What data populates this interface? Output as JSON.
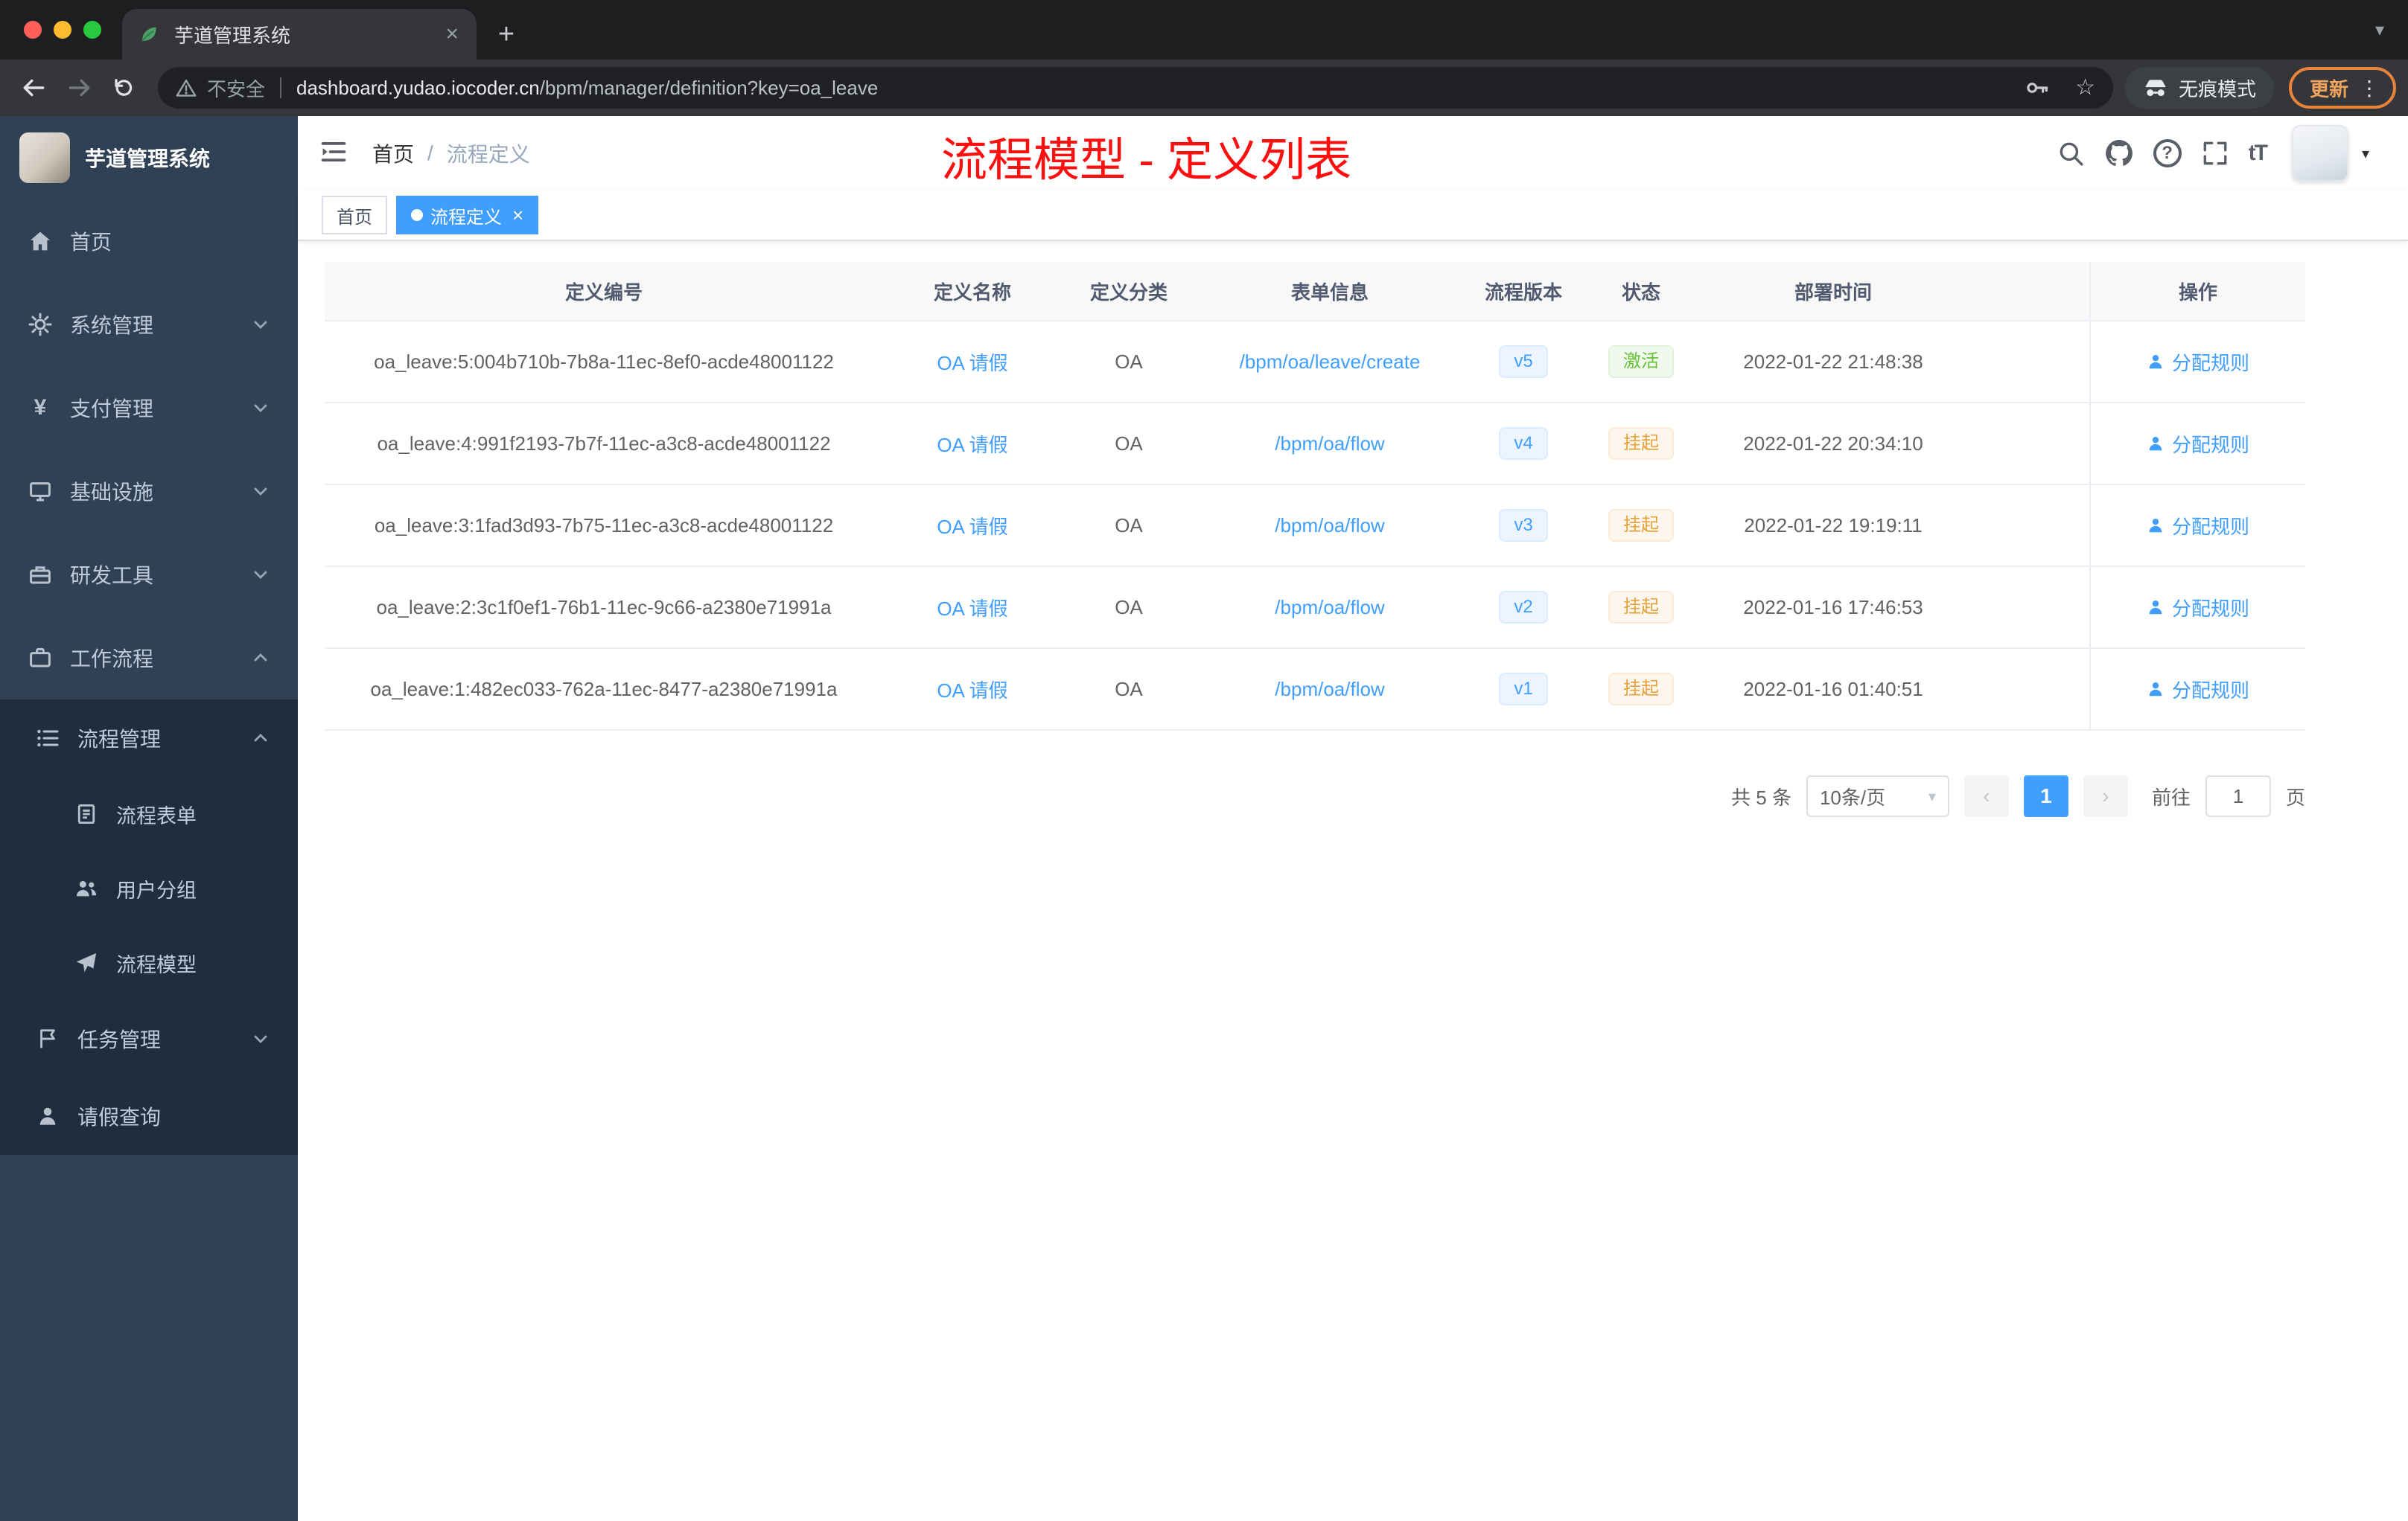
{
  "browser": {
    "tab_title": "芋道管理系统",
    "security_label": "不安全",
    "url_domain": "dashboard.yudao.iocoder.cn",
    "url_path": "/bpm/manager/definition?key=oa_leave",
    "incognito_label": "无痕模式",
    "update_label": "更新"
  },
  "icons": {
    "close": "×",
    "plus": "+",
    "more_vertical": "⋮",
    "star": "☆",
    "yen": "¥",
    "help": "?",
    "caret_down": "▾",
    "font_size": "tT",
    "prev": "‹",
    "next": "›"
  },
  "sidebar": {
    "logo_title": "芋道管理系统",
    "menu": [
      "首页",
      "系统管理",
      "支付管理",
      "基础设施",
      "研发工具",
      "工作流程"
    ],
    "submenu": [
      "流程管理",
      "流程表单",
      "用户分组",
      "流程模型",
      "任务管理",
      "请假查询"
    ]
  },
  "header": {
    "breadcrumb": [
      "首页",
      "流程定义"
    ],
    "separator": "/",
    "annotation": "流程模型 - 定义列表"
  },
  "tags": [
    {
      "label": "首页",
      "active": false
    },
    {
      "label": "流程定义",
      "active": true
    }
  ],
  "table": {
    "columns": [
      "定义编号",
      "定义名称",
      "定义分类",
      "表单信息",
      "流程版本",
      "状态",
      "部署时间",
      "操作"
    ],
    "rows": [
      {
        "id": "oa_leave:5:004b710b-7b8a-11ec-8ef0-acde48001122",
        "name": "OA 请假",
        "category": "OA",
        "form": "/bpm/oa/leave/create",
        "version": "v5",
        "status": "激活",
        "time": "2022-01-22 21:48:38",
        "action": "分配规则"
      },
      {
        "id": "oa_leave:4:991f2193-7b7f-11ec-a3c8-acde48001122",
        "name": "OA 请假",
        "category": "OA",
        "form": "/bpm/oa/flow",
        "version": "v4",
        "status": "挂起",
        "time": "2022-01-22 20:34:10",
        "action": "分配规则"
      },
      {
        "id": "oa_leave:3:1fad3d93-7b75-11ec-a3c8-acde48001122",
        "name": "OA 请假",
        "category": "OA",
        "form": "/bpm/oa/flow",
        "version": "v3",
        "status": "挂起",
        "time": "2022-01-22 19:19:11",
        "action": "分配规则"
      },
      {
        "id": "oa_leave:2:3c1f0ef1-76b1-11ec-9c66-a2380e71991a",
        "name": "OA 请假",
        "category": "OA",
        "form": "/bpm/oa/flow",
        "version": "v2",
        "status": "挂起",
        "time": "2022-01-16 17:46:53",
        "action": "分配规则"
      },
      {
        "id": "oa_leave:1:482ec033-762a-11ec-8477-a2380e71991a",
        "name": "OA 请假",
        "category": "OA",
        "form": "/bpm/oa/flow",
        "version": "v1",
        "status": "挂起",
        "time": "2022-01-16 01:40:51",
        "action": "分配规则"
      }
    ]
  },
  "pagination": {
    "total": "共 5 条",
    "page_size": "10条/页",
    "current_page": "1",
    "goto_label": "前往",
    "goto_value": "1",
    "page_unit": "页"
  }
}
